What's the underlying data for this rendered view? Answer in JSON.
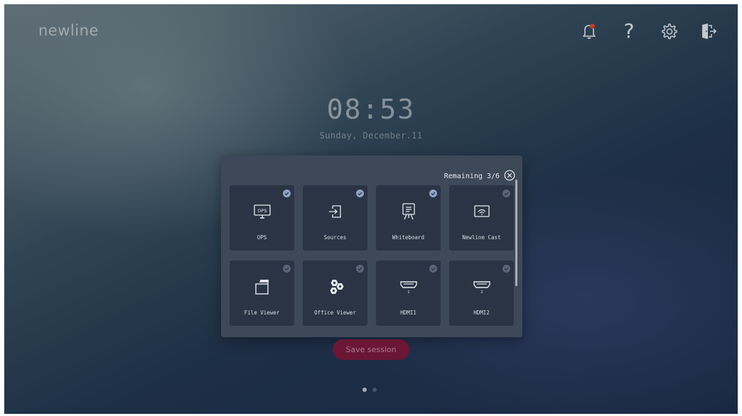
{
  "header": {
    "logo_text": "newline",
    "icons": [
      "notification-bell-icon",
      "help-icon",
      "settings-gear-icon",
      "exit-door-icon"
    ],
    "help_glyph": "?",
    "notification_color": "#c0392b"
  },
  "clock": {
    "time": "08:53",
    "date": "Sunday, December.11"
  },
  "panel": {
    "remaining": "Remaining 3/6",
    "tiles": [
      {
        "label": "OPS",
        "icon": "ops-icon",
        "badge_text": "OPS",
        "selected": true
      },
      {
        "label": "Sources",
        "icon": "sources-input-icon",
        "selected": true
      },
      {
        "label": "Whiteboard",
        "icon": "whiteboard-icon",
        "selected": true
      },
      {
        "label": "Newline Cast",
        "icon": "newline-cast-icon",
        "selected": false
      },
      {
        "label": "File Viewer",
        "icon": "file-viewer-icon",
        "selected": false
      },
      {
        "label": "Office Viewer",
        "icon": "office-viewer-icon",
        "selected": false
      },
      {
        "label": "HDMI1",
        "icon": "hdmi-icon",
        "port": "1",
        "selected": false
      },
      {
        "label": "HDMI2",
        "icon": "hdmi-icon",
        "port": "2",
        "selected": false
      }
    ]
  },
  "save_button": {
    "label": "Save session"
  },
  "pager": {
    "pages": 2,
    "current": 1
  },
  "colors": {
    "check_selected": "#8fa3c8",
    "check_unselected": "#5a6578",
    "save_button": "#6b1634",
    "panel": "#3d4859",
    "tile": "#2a3444"
  }
}
